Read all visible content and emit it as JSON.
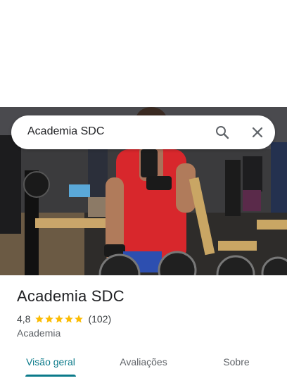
{
  "search": {
    "query": "Academia SDC"
  },
  "place": {
    "name": "Academia SDC",
    "rating": "4,8",
    "stars": 5,
    "review_count": "(102)",
    "category": "Academia"
  },
  "tabs": [
    {
      "label": "Visão geral",
      "active": true
    },
    {
      "label": "Avaliações",
      "active": false
    },
    {
      "label": "Sobre",
      "active": false
    }
  ],
  "colors": {
    "accent": "#0b7a8a",
    "star": "#fbbc04"
  },
  "icons": {
    "search": "search-icon",
    "close": "close-icon",
    "star": "star-icon"
  }
}
